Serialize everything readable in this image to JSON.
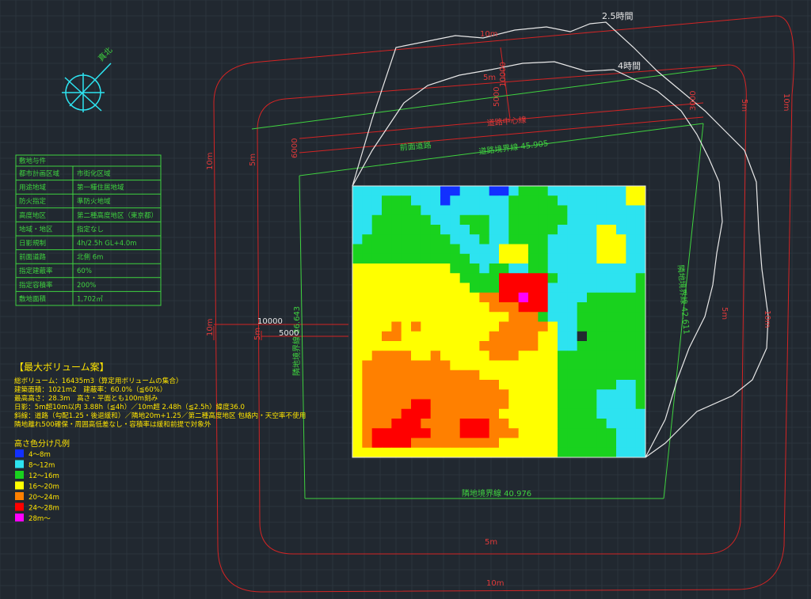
{
  "colors": {
    "background": "#212830",
    "red_line": "#d42424",
    "green_line": "#3fd23f",
    "white_line": "#e8e8e8",
    "yellow_text": "#ffe400",
    "cyan": "#2de3f0"
  },
  "compass": {
    "icon": "north-compass-icon",
    "label": "真北"
  },
  "site_table": {
    "title": "敷地与件",
    "rows": [
      [
        "都市計画区域",
        "市街化区域"
      ],
      [
        "用途地域",
        "第一種住居地域"
      ],
      [
        "防火指定",
        "準防火地域"
      ],
      [
        "高度地区",
        "第二種高度地区（東京都）"
      ],
      [
        "地域・地区",
        "指定なし"
      ],
      [
        "日影規制",
        "4h/2.5h GL+4.0m"
      ],
      [
        "前面道路",
        "北側 6m"
      ],
      [
        "指定建蔽率",
        "60%"
      ],
      [
        "指定容積率",
        "200%"
      ],
      [
        "敷地面積",
        "1,702㎡"
      ]
    ]
  },
  "max_volume": {
    "title": "【最大ボリューム案】",
    "lines": [
      "総ボリューム：16435m3（算定用ボリュームの集合）",
      "建築面積：1021m2　建蔽率：60.0%（≦60%）",
      "最高高さ：28.3m　高さ・平面とも100m刻み",
      "日影：5m超10m以内 3.88h（≦4h）／10m超 2.48h（≦2.5h）緯度36.0",
      "斜線：道路（勾配1.25・後退緩和）／隣地20m+1.25／第二種高度地区 包絡内・天空率不使用",
      "隣地離れ500確保・周囲高低差なし・容積率は緩和前提で対象外"
    ]
  },
  "legend": {
    "title": "高さ色分け凡例",
    "items": [
      {
        "label": "4～8m",
        "color": "#1230ff"
      },
      {
        "label": "8～12m",
        "color": "#2de3f0"
      },
      {
        "label": "12～16m",
        "color": "#19d21e"
      },
      {
        "label": "16～20m",
        "color": "#ffff00"
      },
      {
        "label": "20～24m",
        "color": "#ff8000"
      },
      {
        "label": "24～28m",
        "color": "#ff0000"
      },
      {
        "label": "28m～",
        "color": "#ff00ff"
      }
    ]
  },
  "drawing_labels": {
    "shadow_25": "2.5時間",
    "shadow_4": "4時間",
    "road_center": "道路中心線",
    "front_road": "前面道路",
    "road_boundary": "道路境界線 45.905",
    "adj_left": "隣地境界線 36.643",
    "adj_right": "隣地境界線 42.611",
    "adj_bottom": "隣地境界線 40.976",
    "dim_10000": "10000",
    "dim_5000": "5000",
    "dim_6000": "6000",
    "dim_3000": "3000",
    "dim_10000_v": "10000",
    "dim_5000_v": "5000",
    "m10": "10m",
    "m5": "5m"
  },
  "height_map": {
    "cols": 30,
    "rows": 28,
    "palette": {
      "B": "#1230ff",
      "C": "#2de3f0",
      "G": "#19d21e",
      "Y": "#ffff00",
      "O": "#ff8000",
      "R": "#ff0000",
      "M": "#ff00ff",
      "K": "#222a30"
    },
    "grid": [
      "CCCCCCCCCBBCCCBBCGGGCCCCCCCCYY",
      "CCCGGGCCCBCCCCCCGGGGGCCCCCCCYY",
      "CCCGGGGCCCCCCCCCGGGGGGCCCCCCCC",
      "CCGGGGGGCCCGGGCCGGGGGGCCCCCCCC",
      "CCGGGGGGGCCCGGCCGGGGGCCCCYYCCC",
      "CGGGGGGGGGCCCGCCGGGGCCCCCYYYCC",
      "GGGGGGGGGGGCCCCYYYGGCCCCCYYYCC",
      "GGGGGGGGGGGGCCCYYYGGCCCCCYYYCC",
      "YYYYYYYYYYGGGCGGCCGGCCCCCCCCCC",
      "YYYYYYYYYYYGGGGRRRRRGCCCCCCCCG",
      "YYYYYYYYYYYYGGGRRRRRCCCCCCCCCG",
      "YYYYYYYYYYYYYOORRMRRCCCCGGGGGG",
      "YYYYYYYYYYYYYYOOORRRCCCGGGGGGG",
      "YYYYYYYYYYYYYYYYOOOGCCCGGGGGGG",
      "YYYYOYOYYYYYYYYOOOOOYCCGGGGGGG",
      "YYYOOYYYYYYYYYOOOOOYYCCKGGGGGG",
      "YYYYYYYYYYYYYOOOOOOYYCCGGGGGGG",
      "YYOOOOYYOYYYYYOOOYYYYGGGGGGGGG",
      "YOOOOOOOOOYYYYYYYYYYYGGGGGGGGG",
      "YOOOOOOOOOOOOYYYYYYYYGGGGGGGGG",
      "YOOOOOOOOOOOOOOYYYYYYGGGGGGCCG",
      "YOOOOOOOOOOOOOOOYYYYYGGGGCCCCG",
      "YOOOOORROOOOOOOOYYYYYGGGGCCCCG",
      "YOOOORRROOOOOOOYYYYYYGGGGCCCCC",
      "YOOORRROOOORRROOYYYYYGGGGGCCCC",
      "YORRRRRROOORRROOOYYYYGGGGGGCCC",
      "YORRRROOOOOOOOOYYYYYYGGGGGGCCC",
      "YYYYYYYYYYYYYYYYYYYYYGGGGGGCCC"
    ]
  }
}
